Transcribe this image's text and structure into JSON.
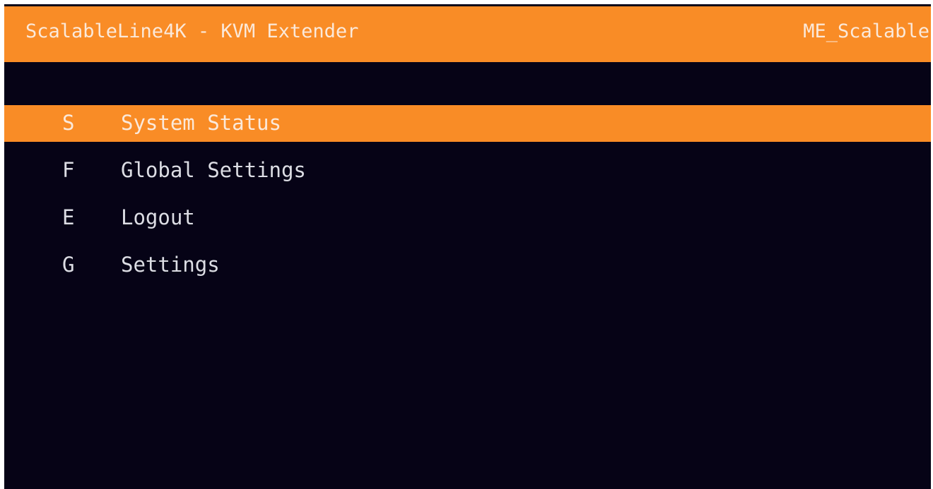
{
  "header": {
    "title": "ScalableLine4K - KVM Extender",
    "device_name": "ME_Scalable"
  },
  "menu": {
    "items": [
      {
        "key": "S",
        "label": "System Status",
        "selected": true
      },
      {
        "key": "F",
        "label": "Global Settings",
        "selected": false
      },
      {
        "key": "E",
        "label": "Logout",
        "selected": false
      },
      {
        "key": "G",
        "label": "Settings",
        "selected": false
      }
    ]
  },
  "colors": {
    "accent": "#f98c26",
    "background": "#060316",
    "text": "#dcdde4"
  }
}
